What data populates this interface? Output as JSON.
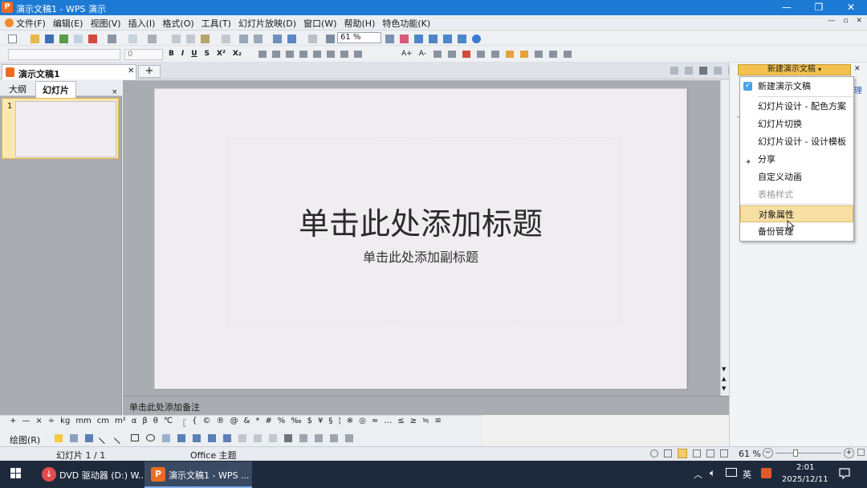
{
  "titlebar": {
    "logo": "P",
    "title": "演示文稿1 - WPS 演示",
    "min": "—",
    "restore": "❐",
    "close": "✕"
  },
  "menubar": {
    "items": [
      "文件(F)",
      "编辑(E)",
      "视图(V)",
      "插入(I)",
      "格式(O)",
      "工具(T)",
      "幻灯片放映(D)",
      "窗口(W)",
      "帮助(H)",
      "特色功能(K)"
    ],
    "mdi": [
      "—",
      "▫",
      "✕"
    ]
  },
  "toolbar": {
    "zoom": "61 %"
  },
  "format_bar": {
    "size": "0",
    "bold": "B",
    "italic": "I",
    "underline": "U",
    "shadow": "S",
    "sup": "X²",
    "sub": "X₂",
    "grow": "A+",
    "shrink": "A-"
  },
  "doc_tab": {
    "label": "演示文稿1",
    "close": "✕",
    "new": "+"
  },
  "left_panel": {
    "tab_outline": "大纲",
    "tab_slides": "幻灯片",
    "close": "×",
    "slide_number": "1"
  },
  "slide": {
    "title": "单击此处添加标题",
    "subtitle": "单击此处添加副标题"
  },
  "notes": {
    "placeholder": "单击此处添加备注"
  },
  "symbols": [
    "+",
    "—",
    "×",
    "÷",
    "kg",
    "mm",
    "cm",
    "m²",
    "α",
    "β",
    "θ",
    "℃",
    "〖",
    "{",
    "©",
    "®",
    "@",
    "&",
    "*",
    "#",
    "%",
    "‰",
    "$",
    "¥",
    "§",
    "¦",
    "※",
    "◎",
    "≈",
    "…",
    "≤",
    "≥",
    "≒",
    "≌"
  ],
  "drawbar": {
    "label": "绘图(R)"
  },
  "status": {
    "slide": "幻灯片 1 / 1",
    "theme": "Office 主题",
    "zoom": "61 %"
  },
  "task_panel": {
    "header": "新建演示文稿",
    "side_text": "理",
    "items": [
      {
        "label": "新建演示文稿",
        "state": "checked"
      },
      {
        "label": "幻灯片设计 - 配色方案",
        "state": "normal"
      },
      {
        "label": "幻灯片切换",
        "state": "normal"
      },
      {
        "label": "幻灯片设计 - 设计模板",
        "state": "normal"
      },
      {
        "label": "分享",
        "state": "pinned"
      },
      {
        "label": "自定义动画",
        "state": "normal"
      },
      {
        "label": "表格样式",
        "state": "disabled"
      },
      {
        "label": "对象属性",
        "state": "hover"
      },
      {
        "label": "备份管理",
        "state": "normal"
      }
    ]
  },
  "taskbar": {
    "app1": "DVD 驱动器 (D:) W...",
    "app2": "演示文稿1 - WPS ...",
    "ime": "英",
    "time": "2:01",
    "date": "2025/12/11"
  },
  "colors": {
    "title_bar": "#1c7ad4",
    "accent_orange": "#ee6b22",
    "hover": "#f7dfa3",
    "panel_header": "#f6c24f",
    "taskbar": "#1e2a3c"
  }
}
